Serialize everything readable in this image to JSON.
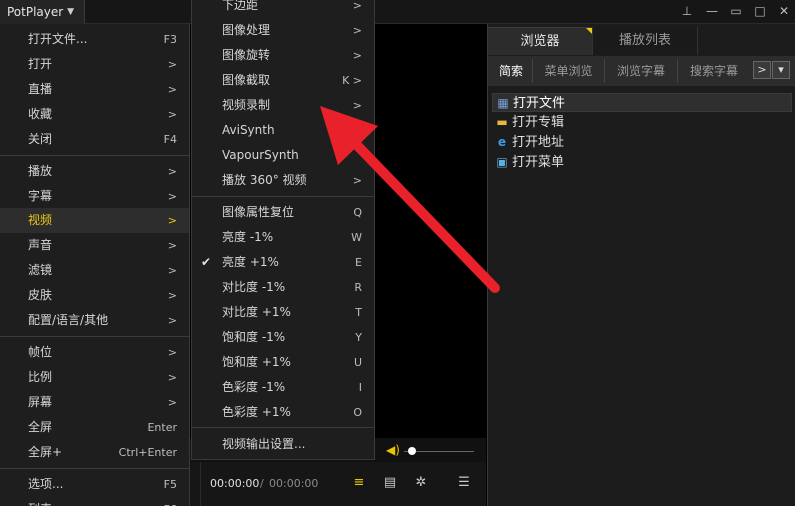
{
  "app": {
    "title": "PotPlayer"
  },
  "window_buttons": {
    "pin": "⊥",
    "minimize": "—",
    "maximize": "□",
    "restore": "▭",
    "close": "✕"
  },
  "main_menu": [
    {
      "label": "打开文件...",
      "right": "F3"
    },
    {
      "label": "打开",
      "right": ">"
    },
    {
      "label": "直播",
      "right": ">"
    },
    {
      "label": "收藏",
      "right": ">"
    },
    {
      "label": "关闭",
      "right": "F4"
    },
    {
      "label": "播放",
      "right": ">"
    },
    {
      "label": "字幕",
      "right": ">"
    },
    {
      "label": "视频",
      "right": ">"
    },
    {
      "label": "声音",
      "right": ">"
    },
    {
      "label": "滤镜",
      "right": ">"
    },
    {
      "label": "皮肤",
      "right": ">"
    },
    {
      "label": "配置/语言/其他",
      "right": ">"
    },
    {
      "label": "帧位",
      "right": ">"
    },
    {
      "label": "比例",
      "right": ">"
    },
    {
      "label": "屏幕",
      "right": ">"
    },
    {
      "label": "全屏",
      "right": "Enter"
    },
    {
      "label": "全屏+",
      "right": "Ctrl+Enter"
    },
    {
      "label": "选项...",
      "right": "F5"
    },
    {
      "label": "列表",
      "right": "F6"
    }
  ],
  "video_submenu": [
    {
      "label": "下边距",
      "right": ">"
    },
    {
      "label": "图像处理",
      "right": ">"
    },
    {
      "label": "图像旋转",
      "right": ">"
    },
    {
      "label": "图像截取",
      "right": "K >"
    },
    {
      "label": "视频录制",
      "right": ">"
    },
    {
      "label": "AviSynth",
      "right": ">"
    },
    {
      "label": "VapourSynth",
      "right": ""
    },
    {
      "label": "播放 360° 视频",
      "right": ">"
    },
    {
      "label": "图像属性复位",
      "right": "Q"
    },
    {
      "label": "亮度 -1%",
      "right": "W"
    },
    {
      "label": "亮度 +1%",
      "right": "E",
      "checked": true
    },
    {
      "label": "对比度 -1%",
      "right": "R"
    },
    {
      "label": "对比度 +1%",
      "right": "T"
    },
    {
      "label": "饱和度 -1%",
      "right": "Y"
    },
    {
      "label": "饱和度 +1%",
      "right": "U"
    },
    {
      "label": "色彩度 -1%",
      "right": "I"
    },
    {
      "label": "色彩度 +1%",
      "right": "O"
    },
    {
      "label": "视频输出设置...",
      "right": ""
    }
  ],
  "controls": {
    "time_current": "00:00:00",
    "time_sep": "/",
    "time_total": "00:00:00",
    "volume_level": 0.05
  },
  "right_panel": {
    "tabs": [
      "浏览器",
      "播放列表"
    ],
    "subtabs": [
      "简索",
      "菜单浏览",
      "浏览字幕",
      "搜索字幕"
    ],
    "nav": [
      ">",
      "▾"
    ],
    "items": [
      {
        "label": "打开文件",
        "icon": "film-icon"
      },
      {
        "label": "打开专辑",
        "icon": "folder-icon"
      },
      {
        "label": "打开地址",
        "icon": "ie-icon"
      },
      {
        "label": "打开菜单",
        "icon": "menu-icon"
      }
    ]
  },
  "colors": {
    "accent": "#f0c419",
    "arrow": "#e8212a",
    "panel": "#1e1e1e"
  }
}
